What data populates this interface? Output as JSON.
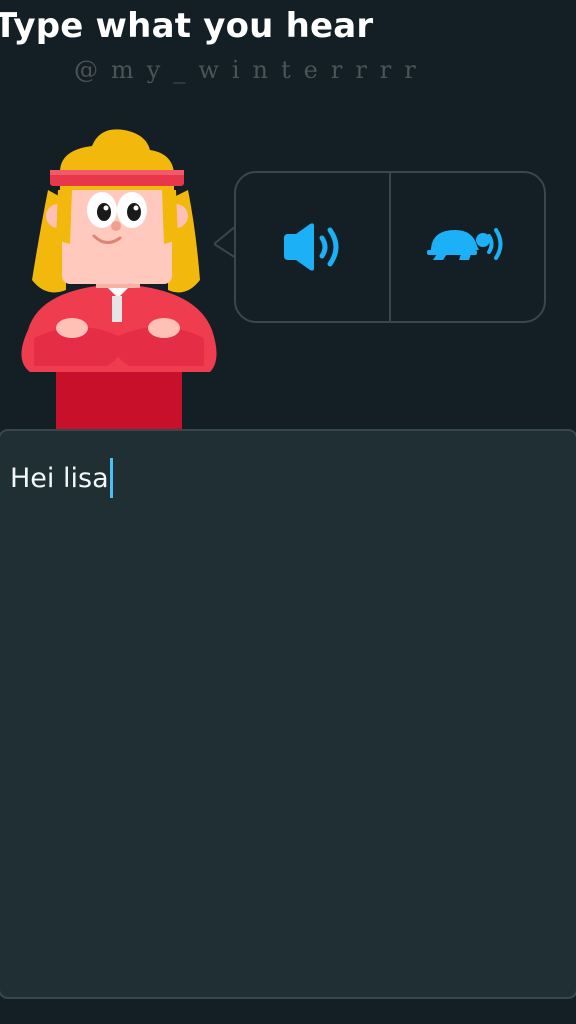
{
  "header": {
    "title": "Type what you hear",
    "watermark": "@my_winterrrr"
  },
  "audio": {
    "normal_icon": "speaker-icon",
    "slow_icon": "turtle-speaker-icon",
    "accent_color": "#1cb0f6"
  },
  "answer": {
    "value": "Hei lisa"
  },
  "colors": {
    "background": "#131f24",
    "input_background": "#202f33",
    "border": "#37464f",
    "caret": "#49c0f8"
  }
}
